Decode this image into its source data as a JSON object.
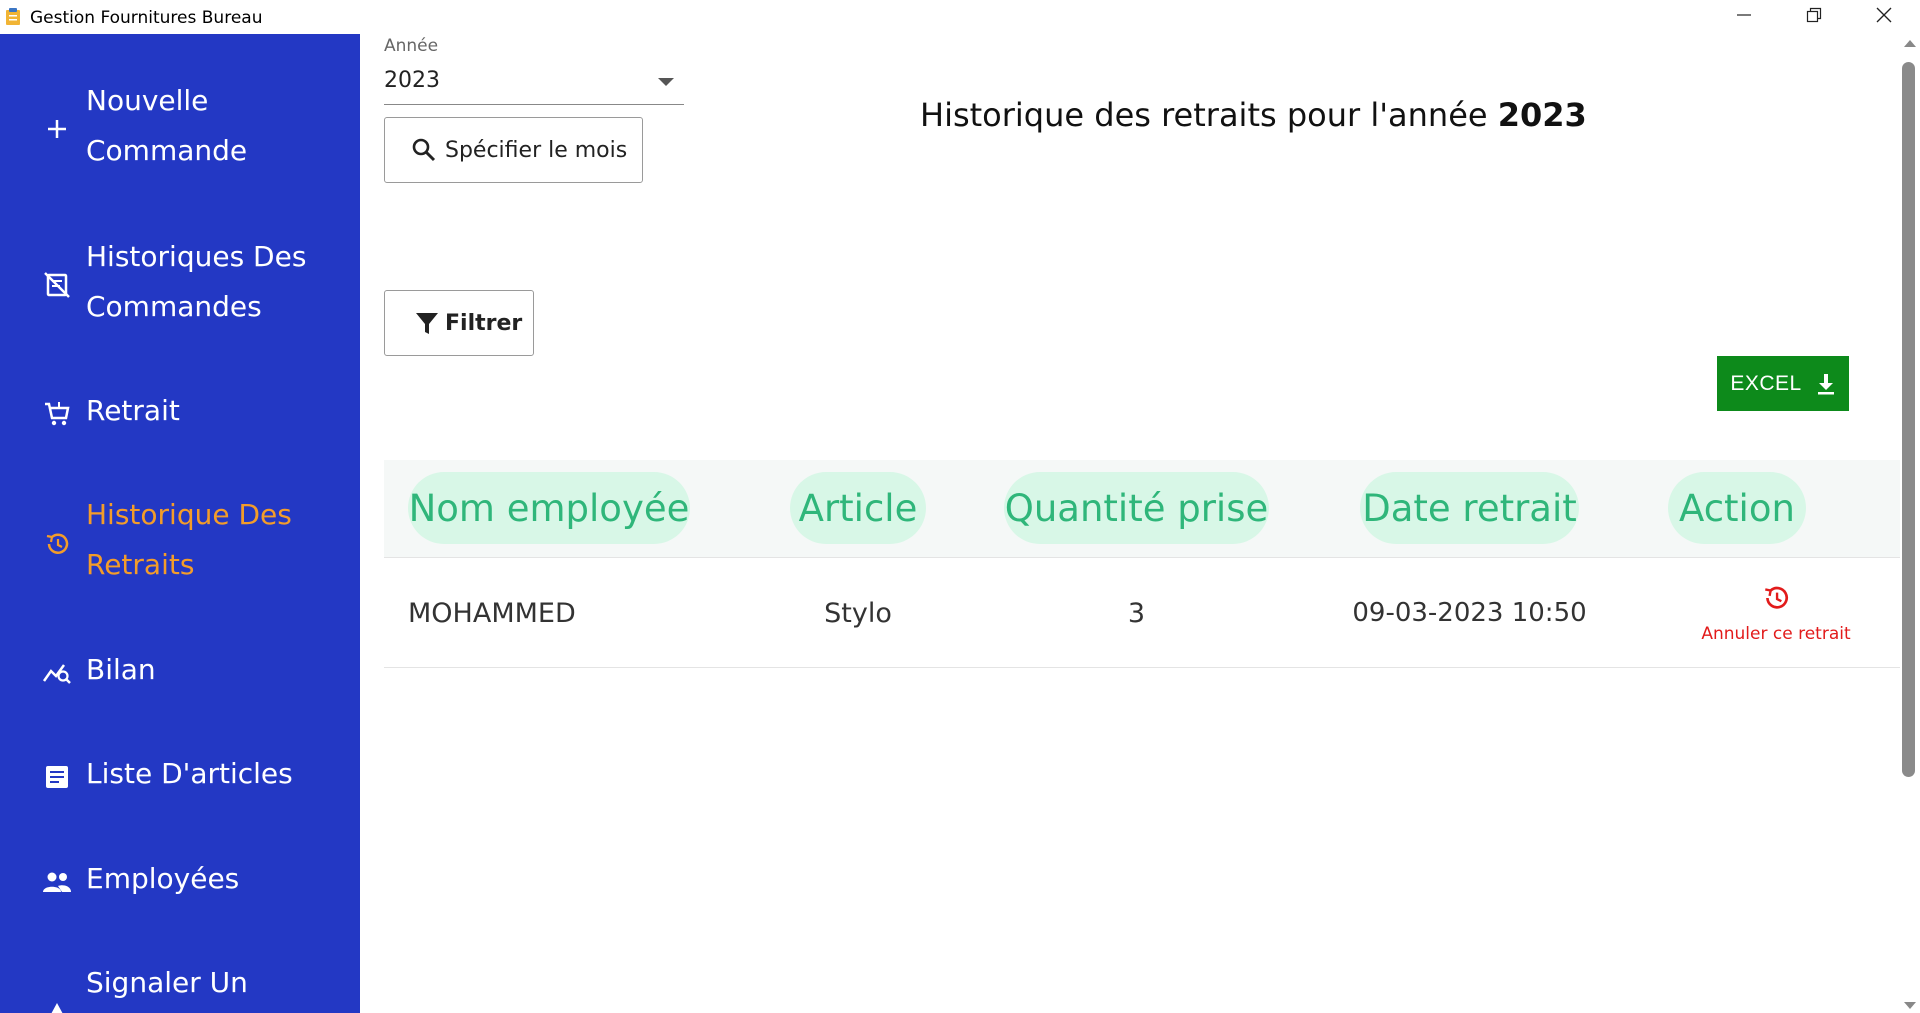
{
  "window": {
    "title": "Gestion Fournitures Bureau",
    "app_icon": "clipboard-icon",
    "controls": {
      "minimize": "minimize-icon",
      "maximize": "restore-icon",
      "close": "close-icon"
    }
  },
  "sidebar": {
    "background": "#2338c4",
    "active_color": "#f39c2a",
    "items": [
      {
        "line1": "Nouvelle",
        "line2": "Commande",
        "icon": "plus-icon",
        "active": false
      },
      {
        "line1": "Historiques Des",
        "line2": "Commandes",
        "icon": "receipt-icon",
        "active": false
      },
      {
        "line1": "Retrait",
        "line2": "",
        "icon": "cart-icon",
        "active": false
      },
      {
        "line1": "Historique Des",
        "line2": "Retraits",
        "icon": "history-icon",
        "active": true
      },
      {
        "line1": "Bilan",
        "line2": "",
        "icon": "analytics-icon",
        "active": false
      },
      {
        "line1": "Liste D'articles",
        "line2": "",
        "icon": "article-icon",
        "active": false
      },
      {
        "line1": "Employées",
        "line2": "",
        "icon": "people-icon",
        "active": false
      },
      {
        "line1": "Signaler Un",
        "line2": "",
        "icon": "warning-icon",
        "active": false
      }
    ]
  },
  "filters": {
    "year_label": "Année",
    "year_value": "2023",
    "month_button": "Spécifier le mois",
    "filter_button": "Filtrer"
  },
  "heading": {
    "prefix": "Historique des retraits pour l'année ",
    "year": "2023"
  },
  "export": {
    "label": "EXCEL",
    "color": "#0d8a1b"
  },
  "table": {
    "header_pill_bg": "#d8f7e7",
    "header_text_color": "#2fb67a",
    "columns": [
      "Nom employée",
      "Article",
      "Quantité prise",
      "Date retrait",
      "Action"
    ],
    "rows": [
      {
        "nom": "MOHAMMED",
        "article": "Stylo",
        "quantite": "3",
        "date": "09-03-2023 10:50",
        "action": "Annuler ce retrait"
      }
    ]
  }
}
